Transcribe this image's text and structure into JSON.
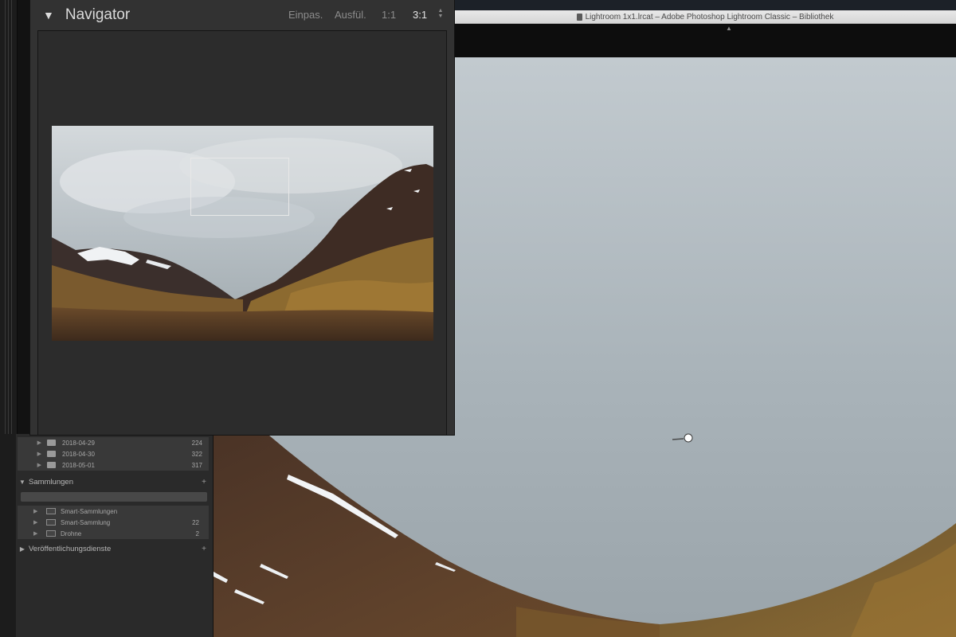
{
  "window": {
    "title": "Lightroom 1x1.lrcat – Adobe Photoshop Lightroom Classic – Bibliothek"
  },
  "navigator": {
    "title": "Navigator",
    "zoom_options": [
      "Einpas.",
      "Ausfül.",
      "1:1",
      "3:1"
    ],
    "selected_zoom": "3:1"
  },
  "folders": [
    {
      "name": "2018-04-29",
      "count": "224"
    },
    {
      "name": "2018-04-30",
      "count": "322"
    },
    {
      "name": "2018-05-01",
      "count": "317"
    }
  ],
  "collections": {
    "header": "Sammlungen",
    "items": [
      {
        "name": "Smart-Sammlungen",
        "count": ""
      },
      {
        "name": "Smart-Sammlung",
        "count": "22"
      },
      {
        "name": "Drohne",
        "count": "2"
      }
    ]
  },
  "publish_services": {
    "header": "Veröffentlichungsdienste"
  },
  "icons": {
    "panel_collapse": "triangle-down-icon",
    "folder": "folder-icon",
    "add": "plus-icon",
    "hand_cursor": "hand-cursor-icon",
    "stepper": "up-down-stepper-icon"
  },
  "colors": {
    "panel_bg": "#323232",
    "panel_dark": "#2a2a2a",
    "sky": "#a4aeb3",
    "mountain": "#5a3d29",
    "grass": "#9b7433",
    "snow": "#f2f4f6"
  }
}
